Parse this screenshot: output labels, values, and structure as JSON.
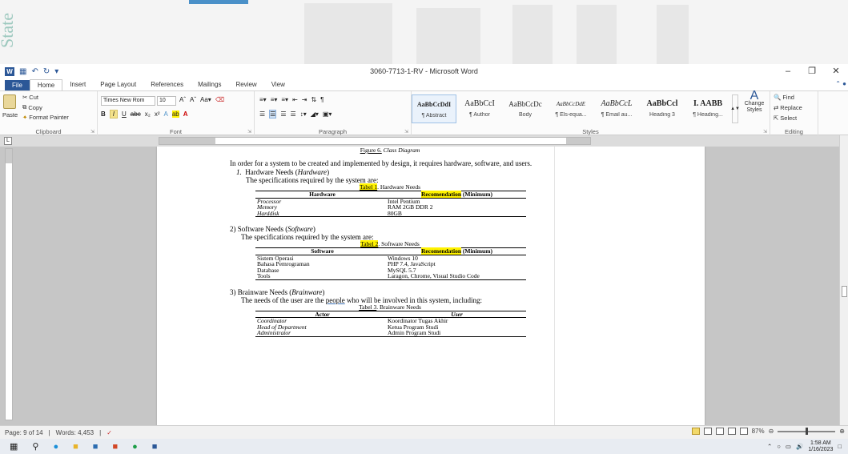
{
  "background": {
    "side_text": "State"
  },
  "window": {
    "title": "3060-7713-1-RV - Microsoft Word",
    "app_logo": "W"
  },
  "tabs": [
    "File",
    "Home",
    "Insert",
    "Page Layout",
    "References",
    "Mailings",
    "Review",
    "View"
  ],
  "ribbon": {
    "clipboard": {
      "paste": "Paste",
      "cut": "Cut",
      "copy": "Copy",
      "format_painter": "Format Painter",
      "label": "Clipboard"
    },
    "font": {
      "name": "Times New Rom",
      "size": "10",
      "label": "Font"
    },
    "paragraph": {
      "label": "Paragraph"
    },
    "styles": {
      "items": [
        {
          "preview": "AaBbCcDdI",
          "name": "¶ Abstract"
        },
        {
          "preview": "AaBbCcI",
          "name": "¶ Author"
        },
        {
          "preview": "AaBbCcDc",
          "name": "Body"
        },
        {
          "preview": "AaBbCcDdE",
          "name": "¶ Els-equa..."
        },
        {
          "preview": "AaBbCcL",
          "name": "¶ Email au..."
        },
        {
          "preview": "AaBbCcl",
          "name": "Heading 3"
        },
        {
          "preview": "I. AABB",
          "name": "¶ Heading..."
        }
      ],
      "change_styles": "Change Styles",
      "label": "Styles"
    },
    "editing": {
      "find": "Find",
      "replace": "Replace",
      "select": "Select",
      "label": "Editing"
    }
  },
  "document": {
    "figure_caption_prefix": "Figure 6.",
    "figure_caption_title": "Class Diagram",
    "intro": "In order for a system to be created and implemented by design, it requires hardware, software, and users.",
    "hardware": {
      "heading_num": "1.",
      "heading_text": "Hardware Needs (",
      "heading_italic": "Hardware",
      "heading_close": ")",
      "lead": "The specifications required by the system are:",
      "caption_label": "Tabel 1",
      "caption_rest": ". Hardware Needs",
      "col1": "Hardware",
      "col2_hl": "Recomendation",
      "col2_rest": " (Minimum)",
      "rows": [
        {
          "a": "Processor",
          "b": "Intel Pentium"
        },
        {
          "a": "Memory",
          "b": "RAM 2GB DDR 2"
        },
        {
          "a": "Harddisk",
          "b": "80GB"
        }
      ]
    },
    "software": {
      "heading_text": "2) Software Needs (",
      "heading_italic": "Software",
      "heading_close": ")",
      "lead": "The specifications required by the system are:",
      "caption_label": "Tabel 2",
      "caption_rest": ". Software Needs",
      "col1": "Software",
      "col2_hl": "Recomendation",
      "col2_rest": " (Minimum)",
      "rows": [
        {
          "a": "Sistem Operasi",
          "b": "Windows 10"
        },
        {
          "a": "Bahasa Pemrograman",
          "b": "PHP 7.4, JavaScript"
        },
        {
          "a": "Database",
          "b": "MySQL 5.7"
        },
        {
          "a": "Tools",
          "b": "Laragon, Chrome, Visual Studio Code"
        }
      ]
    },
    "brainware": {
      "heading_text": "3) Brainware Needs (",
      "heading_italic": "Brainware",
      "heading_close": ")",
      "lead_pre": "The needs of the user are the ",
      "lead_link": "people",
      "lead_post": " who will be involved in this system, including:",
      "caption_label": "Tabel 3",
      "caption_rest": ". Brainware Needs",
      "col1": "Actor",
      "col2": "User",
      "rows": [
        {
          "a": "Coordinator",
          "b": "Koordinator Tugas Akhir"
        },
        {
          "a": "Head of Department",
          "b": "Ketua Program Studi"
        },
        {
          "a": "Administrator",
          "b": "Admin Program Studi"
        }
      ]
    }
  },
  "status": {
    "page": "Page: 9 of 14",
    "words": "Words: 4,453",
    "zoom": "87%"
  },
  "taskbar": {
    "time": "1:58 AM",
    "date": "1/16/2023"
  }
}
